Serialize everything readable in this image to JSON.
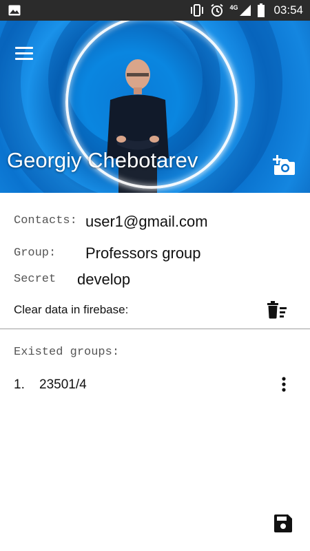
{
  "status_bar": {
    "time": "03:54",
    "network": "4G",
    "icons": [
      "image-notification-icon",
      "vibrate-icon",
      "alarm-icon",
      "signal-4g-icon",
      "battery-icon"
    ]
  },
  "header": {
    "name": "Georgiy Chebotarev",
    "menu_icon": "hamburger-menu-icon",
    "add_photo_icon": "add-photo-camera-icon",
    "accent": "#0a86e0"
  },
  "info": {
    "contacts_label": "Contacts:",
    "contacts_value": "user1@gmail.com",
    "group_label": "Group:",
    "group_value": "Professors group",
    "secret_label": "Secret",
    "secret_value": "develop",
    "clear_label": "Clear data in firebase:",
    "clear_icon": "delete-sweep-icon"
  },
  "groups": {
    "title": "Existed groups:",
    "items": [
      {
        "index": "1.",
        "name": "23501/4",
        "menu_icon": "more-vert-icon"
      }
    ]
  },
  "footer": {
    "save_icon": "save-icon"
  }
}
